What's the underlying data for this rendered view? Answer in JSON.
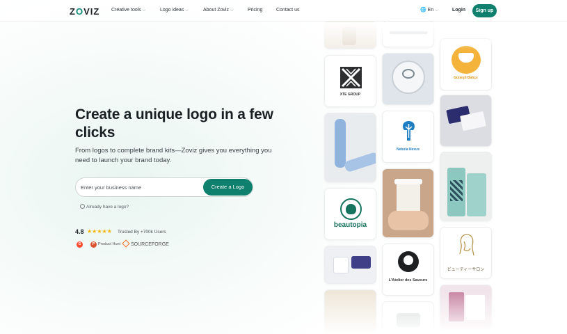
{
  "nav": {
    "logo": "ZOVIZ",
    "items": [
      {
        "label": "Creative tools",
        "has_menu": true
      },
      {
        "label": "Logo ideas",
        "has_menu": true
      },
      {
        "label": "About Zoviz",
        "has_menu": true
      },
      {
        "label": "Pricing",
        "has_menu": false
      },
      {
        "label": "Contact us",
        "has_menu": false
      }
    ],
    "language": "En",
    "login": "Login",
    "signup": "Sign up"
  },
  "hero": {
    "title": "Create a unique logo in a few clicks",
    "subtitle": "From logos to complete brand kits—Zoviz gives you everything you need to launch your brand today.",
    "search_placeholder": "Enter your business name",
    "cta": "Create a Logo",
    "have_logo": "Already have a logo?",
    "rating": "4.8",
    "trusted": "Trusted By +700k Users",
    "badges": {
      "g2": "G",
      "producthunt": "Product Hunt",
      "sourceforge": "SOURCEFORGE"
    }
  },
  "gallery": {
    "xte": "XTE GROUP",
    "gunesli": "Güneşli Bahçe",
    "nebula": "Nebula Nexus",
    "beautopia": "beautopia",
    "atelier": "L'Atelier des Saveurs",
    "beauty_salon": "ビューティーサロン"
  },
  "colors": {
    "brand": "#0f7f6e",
    "star": "#f5b301"
  }
}
